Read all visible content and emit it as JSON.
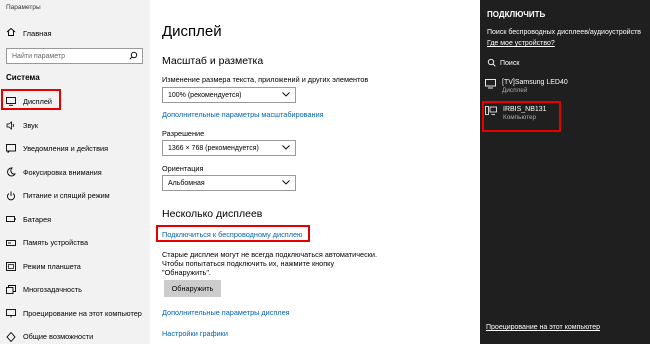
{
  "app": {
    "title": "Параметры"
  },
  "sidebar": {
    "home": "Главная",
    "search_placeholder": "Найти параметр",
    "group": "Система",
    "items": [
      {
        "label": "Дисплей",
        "icon": "monitor-icon"
      },
      {
        "label": "Звук",
        "icon": "speaker-icon"
      },
      {
        "label": "Уведомления и действия",
        "icon": "notification-icon"
      },
      {
        "label": "Фокусировка внимания",
        "icon": "moon-icon"
      },
      {
        "label": "Питание и спящий режим",
        "icon": "power-icon"
      },
      {
        "label": "Батарея",
        "icon": "battery-icon"
      },
      {
        "label": "Память устройства",
        "icon": "storage-icon"
      },
      {
        "label": "Режим планшета",
        "icon": "tablet-icon"
      },
      {
        "label": "Многозадачность",
        "icon": "multitask-icon"
      },
      {
        "label": "Проецирование на этот компьютер",
        "icon": "project-icon"
      },
      {
        "label": "Общие возможности",
        "icon": "shared-icon"
      }
    ]
  },
  "main": {
    "title": "Дисплей",
    "scale_heading": "Масштаб и разметка",
    "text_size_label": "Изменение размера текста, приложений и других элементов",
    "text_size_value": "100% (рекомендуется)",
    "advanced_scaling_link": "Дополнительные параметры масштабирования",
    "resolution_label": "Разрешение",
    "resolution_value": "1366 × 768 (рекомендуется)",
    "orientation_label": "Ориентация",
    "orientation_value": "Альбомная",
    "multi_heading": "Несколько дисплеев",
    "wireless_link": "Подключиться к беспроводному дисплею",
    "old_displays_line1": "Старые дисплеи могут не всегда подключаться автоматически.",
    "old_displays_line2": "Чтобы попытаться подключить их, нажмите кнопку",
    "old_displays_line3": "\"Обнаружить\".",
    "detect_button": "Обнаружить",
    "advanced_display_link": "Дополнительные параметры дисплея",
    "graphics_link": "Настройки графики"
  },
  "panel": {
    "title": "ПОДКЛЮЧИТЬ",
    "searching": "Поиск беспроводных дисплеев/аудиоустройств",
    "where_link": "Где мое устройство?",
    "search_label": "Поиск",
    "devices": [
      {
        "name": "[TV]Samsung LED40",
        "type": "Дисплей"
      },
      {
        "name": "IRBIS_NB131",
        "type": "Компьютер"
      }
    ],
    "project_link": "Проецирование на этот компьютер"
  },
  "colors": {
    "highlight": "#e60000",
    "link": "#0063b1",
    "panel_bg": "#1f1f1f",
    "sidebar_bg": "#f2f2f2"
  }
}
